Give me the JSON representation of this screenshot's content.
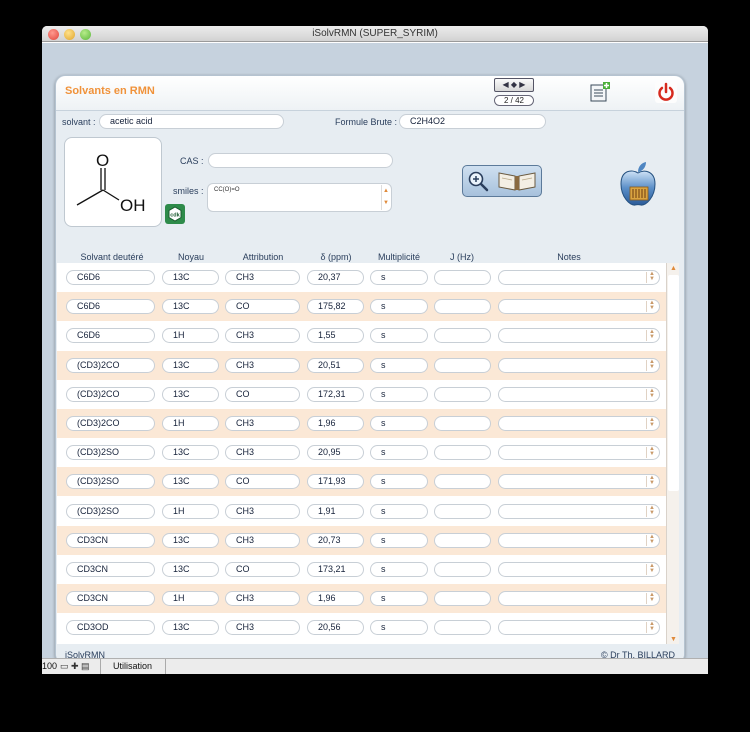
{
  "window": {
    "title": "iSolvRMN (SUPER_SYRIM)"
  },
  "panel": {
    "title": "Solvants en RMN",
    "nav": {
      "arrows": "◀ ◆ ▶",
      "record": "2 / 42"
    }
  },
  "form": {
    "solvent_label": "solvant :",
    "solvent_value": "acetic acid",
    "formula_label": "Formule Brute :",
    "formula_value": "C2H4O2",
    "cas_label": "CAS :",
    "cas_value": "",
    "smiles_label": "smiles :",
    "smiles_value": "CC(O)=O"
  },
  "molecule": {
    "atom_o": "O",
    "atom_oh": "OH"
  },
  "table": {
    "headers": [
      "Solvant deutéré",
      "Noyau",
      "Attribution",
      "δ (ppm)",
      "Multiplicité",
      "J (Hz)",
      "Notes"
    ],
    "rows": [
      {
        "solvent": "C6D6",
        "nucleus": "13C",
        "attribution": "CH3",
        "delta": "20,37",
        "mult": "s",
        "j": "",
        "notes": ""
      },
      {
        "solvent": "C6D6",
        "nucleus": "13C",
        "attribution": "CO",
        "delta": "175,82",
        "mult": "s",
        "j": "",
        "notes": ""
      },
      {
        "solvent": "C6D6",
        "nucleus": "1H",
        "attribution": "CH3",
        "delta": "1,55",
        "mult": "s",
        "j": "",
        "notes": ""
      },
      {
        "solvent": "(CD3)2CO",
        "nucleus": "13C",
        "attribution": "CH3",
        "delta": "20,51",
        "mult": "s",
        "j": "",
        "notes": ""
      },
      {
        "solvent": "(CD3)2CO",
        "nucleus": "13C",
        "attribution": "CO",
        "delta": "172,31",
        "mult": "s",
        "j": "",
        "notes": ""
      },
      {
        "solvent": "(CD3)2CO",
        "nucleus": "1H",
        "attribution": "CH3",
        "delta": "1,96",
        "mult": "s",
        "j": "",
        "notes": ""
      },
      {
        "solvent": "(CD3)2SO",
        "nucleus": "13C",
        "attribution": "CH3",
        "delta": "20,95",
        "mult": "s",
        "j": "",
        "notes": ""
      },
      {
        "solvent": "(CD3)2SO",
        "nucleus": "13C",
        "attribution": "CO",
        "delta": "171,93",
        "mult": "s",
        "j": "",
        "notes": ""
      },
      {
        "solvent": "(CD3)2SO",
        "nucleus": "1H",
        "attribution": "CH3",
        "delta": "1,91",
        "mult": "s",
        "j": "",
        "notes": ""
      },
      {
        "solvent": "CD3CN",
        "nucleus": "13C",
        "attribution": "CH3",
        "delta": "20,73",
        "mult": "s",
        "j": "",
        "notes": ""
      },
      {
        "solvent": "CD3CN",
        "nucleus": "13C",
        "attribution": "CO",
        "delta": "173,21",
        "mult": "s",
        "j": "",
        "notes": ""
      },
      {
        "solvent": "CD3CN",
        "nucleus": "1H",
        "attribution": "CH3",
        "delta": "1,96",
        "mult": "s",
        "j": "",
        "notes": ""
      },
      {
        "solvent": "CD3OD",
        "nucleus": "13C",
        "attribution": "CH3",
        "delta": "20,56",
        "mult": "s",
        "j": "",
        "notes": ""
      }
    ]
  },
  "footer": {
    "left": "iSolvRMN",
    "right": "© Dr Th. BILLARD"
  },
  "statusbar": {
    "zoom": "100",
    "mode": "Utilisation"
  },
  "colors": {
    "accent_orange": "#f0923a",
    "row_tint": "#fbe8d6",
    "panel_bg": "#e7edf2"
  }
}
